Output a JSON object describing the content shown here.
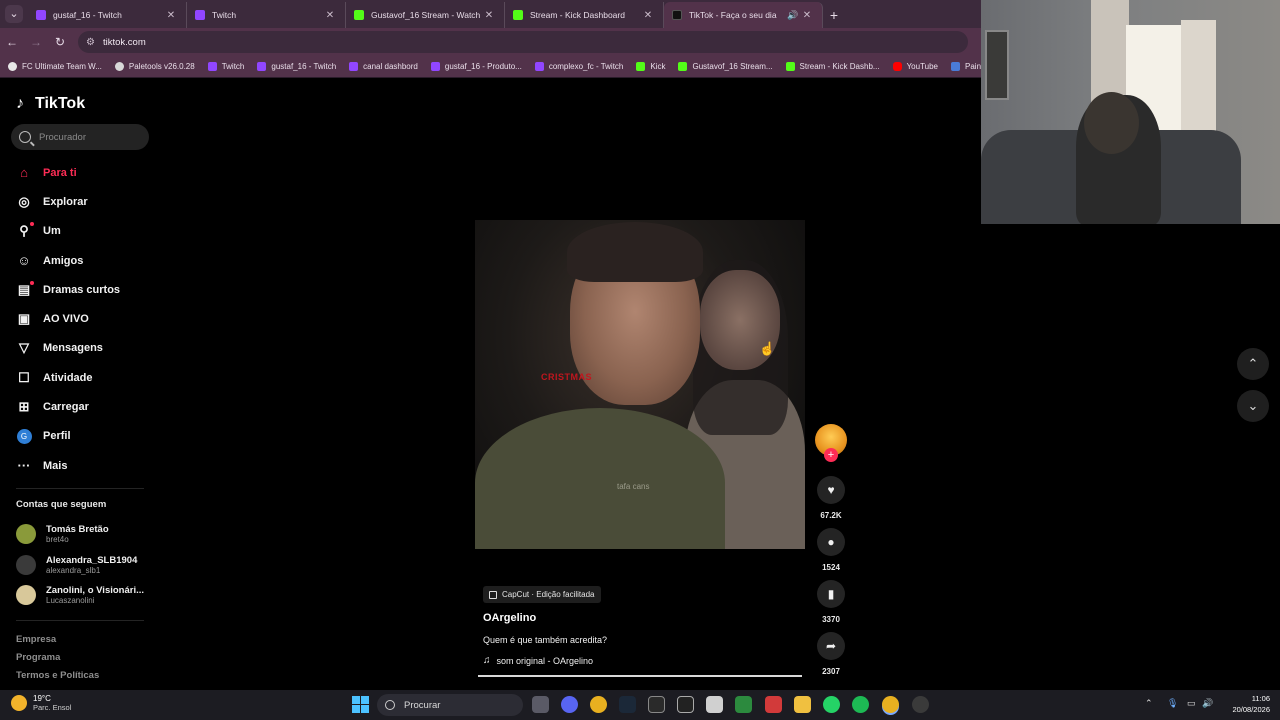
{
  "browser": {
    "tabs": [
      {
        "title": "gustaf_16 - Twitch",
        "favicon": "twitch-icon",
        "active": false
      },
      {
        "title": "Twitch",
        "favicon": "twitch-icon",
        "active": false
      },
      {
        "title": "Gustavof_16 Stream - Watch Li",
        "favicon": "kick-icon",
        "active": false
      },
      {
        "title": "Stream - Kick Dashboard",
        "favicon": "kick-icon",
        "active": false
      },
      {
        "title": "TikTok - Faça o seu dia",
        "favicon": "tiktok-icon",
        "active": true
      }
    ],
    "address": "tiktok.com",
    "bookmarks": [
      {
        "label": "FC Ultimate Team W...",
        "icon": "fc-icon"
      },
      {
        "label": "Paletools v26.0.28",
        "icon": "paletools-icon"
      },
      {
        "label": "Twitch",
        "icon": "twitch-icon"
      },
      {
        "label": "gustaf_16 - Twitch",
        "icon": "twitch-icon"
      },
      {
        "label": "canal dashbord",
        "icon": "twitch-icon"
      },
      {
        "label": "gustaf_16 - Produto...",
        "icon": "twitch-icon"
      },
      {
        "label": "complexo_fc - Twitch",
        "icon": "twitch-icon"
      },
      {
        "label": "Kick",
        "icon": "kick-icon"
      },
      {
        "label": "Gustavof_16 Stream...",
        "icon": "kick-icon"
      },
      {
        "label": "Stream - Kick Dashb...",
        "icon": "kick-icon"
      },
      {
        "label": "YouTube",
        "icon": "youtube-icon"
      },
      {
        "label": "Painel - Bah",
        "icon": "panel-icon"
      }
    ]
  },
  "tiktok": {
    "logo": "TikTok",
    "search_placeholder": "Procurador",
    "nav": [
      {
        "label": "Para ti",
        "icon": "home-icon",
        "active": true
      },
      {
        "label": "Explorar",
        "icon": "compass-icon",
        "active": false
      },
      {
        "label": "Um",
        "icon": "user-follow-icon",
        "active": false,
        "badge": true
      },
      {
        "label": "Amigos",
        "icon": "friends-icon",
        "active": false
      },
      {
        "label": "Dramas curtos",
        "icon": "film-icon",
        "active": false,
        "badge": true
      },
      {
        "label": "AO VIVO",
        "icon": "live-icon",
        "active": false
      },
      {
        "label": "Mensagens",
        "icon": "send-icon",
        "active": false
      },
      {
        "label": "Atividade",
        "icon": "activity-icon",
        "active": false
      },
      {
        "label": "Carregar",
        "icon": "upload-icon",
        "active": false
      },
      {
        "label": "Perfil",
        "icon": "avatar-icon",
        "active": false,
        "avatar_letter": "G"
      },
      {
        "label": "Mais",
        "icon": "more-icon",
        "active": false
      }
    ],
    "following_title": "Contas que seguem",
    "following": [
      {
        "name": "Tomás Bretão",
        "handle": "bret4o",
        "color": "#8a9a3a"
      },
      {
        "name": "Alexandra_SLB1904",
        "handle": "alexandra_slb1",
        "color": "#3a3a3a"
      },
      {
        "name": "Zanolini, o Visionári...",
        "handle": "Lucaszanolini",
        "color": "#d8c89a"
      }
    ],
    "footer": [
      "Empresa",
      "Programa",
      "Termos e Políticas"
    ],
    "video": {
      "overlay_red_text": "CRISTMAS",
      "overlay_subtitle": "tafa cans",
      "effect_tag": "CapCut · Edição facilitada",
      "author": "OArgelino",
      "description": "Quem é que também acredita?",
      "music": "som original - OArgelino",
      "progress": 1.0
    },
    "actions": {
      "likes": "67.2K",
      "comments": "1524",
      "saves": "3370",
      "shares": "2307"
    }
  },
  "taskbar": {
    "weather_temp": "19°C",
    "weather_desc": "Parc. Ensol",
    "search_label": "Procurar",
    "time": "11:06",
    "date": "20/08/2026"
  }
}
